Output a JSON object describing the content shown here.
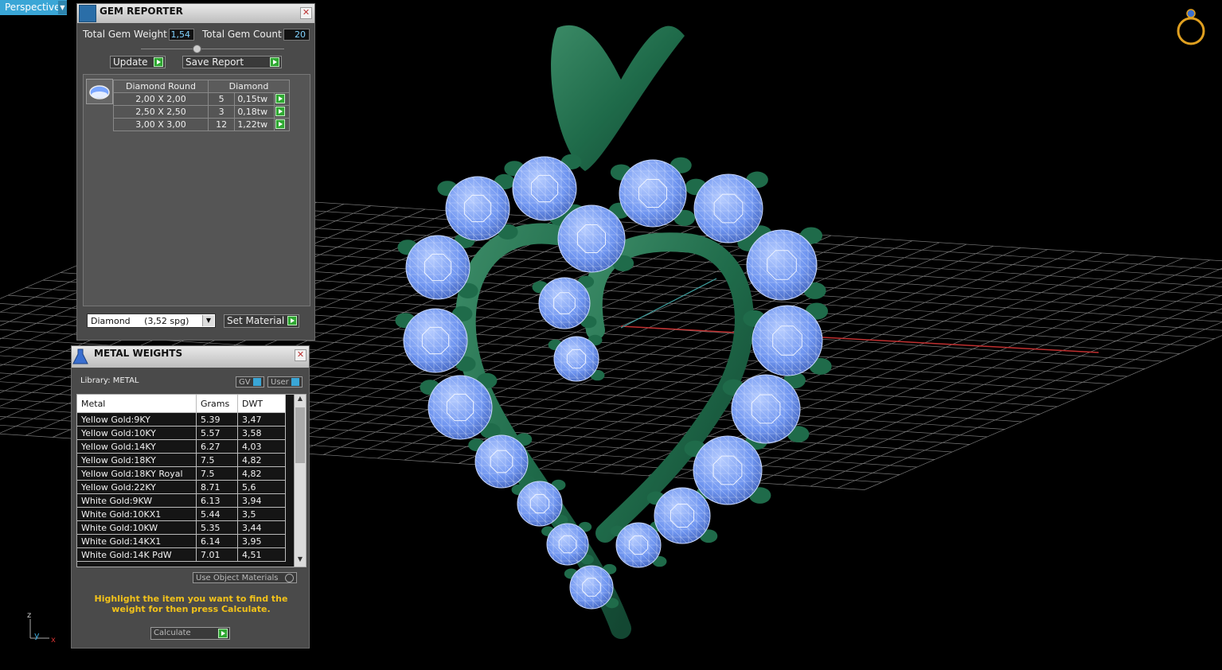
{
  "viewport": {
    "mode_label": "Perspective"
  },
  "gem_reporter": {
    "title": "GEM REPORTER",
    "total_weight_label": "Total Gem Weight",
    "total_weight_value": "1,54",
    "total_count_label": "Total Gem Count",
    "total_count_value": "20",
    "update_label": "Update",
    "save_report_label": "Save Report",
    "table_header_shape": "Diamond Round",
    "table_header_material": "Diamond",
    "rows": [
      {
        "size": "2,00 X 2,00",
        "count": "5",
        "weight": "0,15tw"
      },
      {
        "size": "2,50 X 2,50",
        "count": "3",
        "weight": "0,18tw"
      },
      {
        "size": "3,00 X 3,00",
        "count": "12",
        "weight": "1,22tw"
      }
    ],
    "material_select": "Diamond     (3,52 spg)",
    "set_material_label": "Set Material"
  },
  "metal_weights": {
    "title": "METAL WEIGHTS",
    "library_label": "Library: METAL",
    "gv_label": "GV",
    "user_label": "User",
    "columns": [
      "Metal",
      "Grams",
      "DWT"
    ],
    "rows": [
      [
        "Yellow Gold:9KY",
        "5.39",
        "3,47"
      ],
      [
        "Yellow Gold:10KY",
        "5.57",
        "3,58"
      ],
      [
        "Yellow Gold:14KY",
        "6.27",
        "4,03"
      ],
      [
        "Yellow Gold:18KY",
        "7.5",
        "4,82"
      ],
      [
        "Yellow Gold:18KY Royal",
        "7.5",
        "4,82"
      ],
      [
        "Yellow Gold:22KY",
        "8.71",
        "5,6"
      ],
      [
        "White Gold:9KW",
        "6.13",
        "3,94"
      ],
      [
        "White Gold:10KX1",
        "5.44",
        "3,5"
      ],
      [
        "White Gold:10KW",
        "5.35",
        "3,44"
      ],
      [
        "White Gold:14KX1",
        "6.14",
        "3,95"
      ],
      [
        "White Gold:14K PdW",
        "7.01",
        "4,51"
      ]
    ],
    "use_object_materials_label": "Use Object Materials",
    "instruction": "Highlight the item you want to find the weight for then press Calculate.",
    "calculate_label": "Calculate"
  },
  "axis": {
    "z": "z",
    "y": "y",
    "x": "x"
  },
  "colors": {
    "metal_green": "#1f6b4a",
    "gem_blue": "#7aa6ff",
    "grid": "#8a8a8a",
    "accent_blue": "#3aa6d6",
    "go_green": "#2fa832"
  }
}
